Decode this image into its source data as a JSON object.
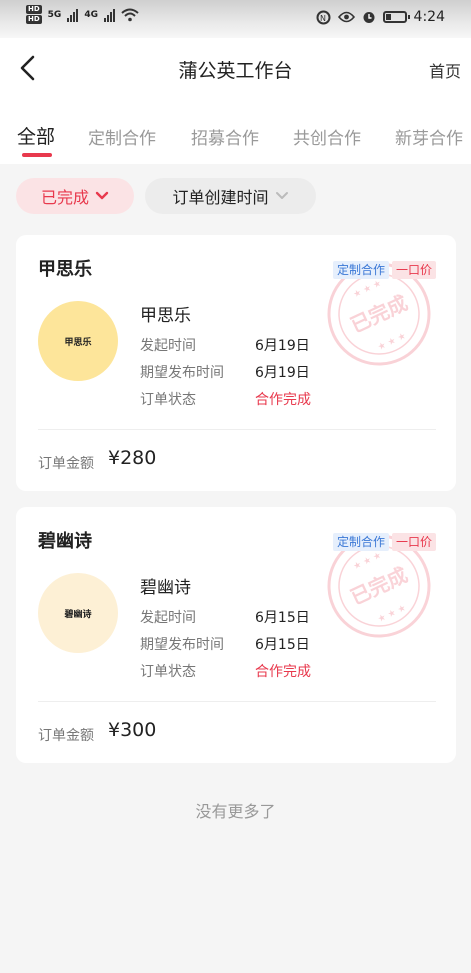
{
  "status_bar": {
    "time": "4:24",
    "hd1": "HD",
    "hd2": "HD",
    "net1": "5G",
    "net2": "4G"
  },
  "nav": {
    "title": "蒲公英工作台",
    "home": "首页"
  },
  "tabs": [
    {
      "label": "全部",
      "active": true
    },
    {
      "label": "定制合作"
    },
    {
      "label": "招募合作"
    },
    {
      "label": "共创合作"
    },
    {
      "label": "新芽合作"
    }
  ],
  "filters": {
    "status": "已完成",
    "sort": "订单创建时间"
  },
  "orders": [
    {
      "title": "甲思乐",
      "badge_type": "定制合作",
      "badge_price": "一口价",
      "avatar_text": "甲思乐",
      "avatar_color": "#fde59a",
      "name": "甲思乐",
      "start_label": "发起时间",
      "start_value": "6月19日",
      "expect_label": "期望发布时间",
      "expect_value": "6月19日",
      "status_label": "订单状态",
      "status_value": "合作完成",
      "amount_label": "订单金额",
      "amount_value": "¥280",
      "stamp_text": "已完成"
    },
    {
      "title": "碧幽诗",
      "badge_type": "定制合作",
      "badge_price": "一口价",
      "avatar_text": "碧幽诗",
      "avatar_color": "#fdf0d5",
      "name": "碧幽诗",
      "start_label": "发起时间",
      "start_value": "6月15日",
      "expect_label": "期望发布时间",
      "expect_value": "6月15日",
      "status_label": "订单状态",
      "status_value": "合作完成",
      "amount_label": "订单金额",
      "amount_value": "¥300",
      "stamp_text": "已完成"
    }
  ],
  "footer": {
    "no_more": "没有更多了"
  },
  "colors": {
    "accent": "#e8394d",
    "blue": "#3b78d6"
  }
}
